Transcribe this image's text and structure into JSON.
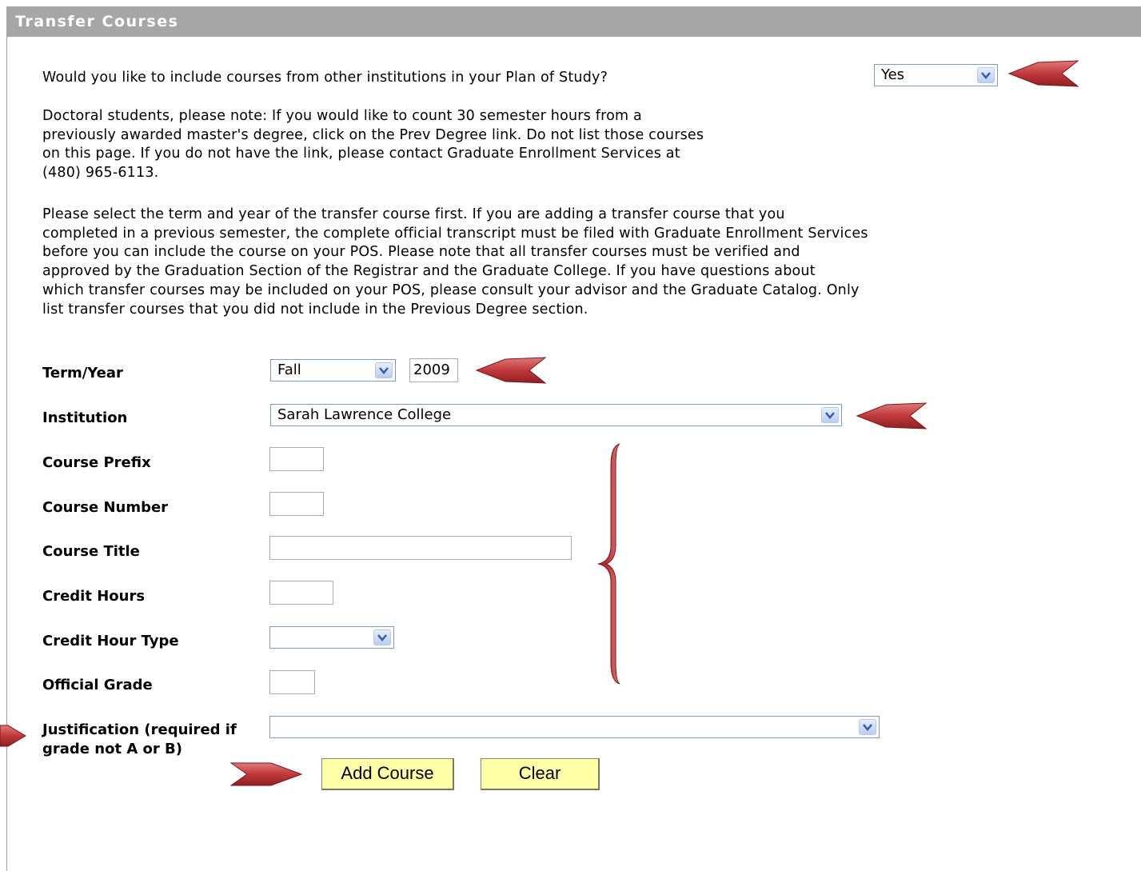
{
  "header": {
    "title": "Transfer Courses"
  },
  "intro": {
    "question": "Would you like to include courses from other institutions in your Plan of Study?",
    "include_value": "Yes",
    "note_lines": [
      "Doctoral students, please note: If you would like to count 30 semester hours from a",
      "previously awarded master's degree, click on the Prev Degree link. Do not list those courses",
      "on this page. If you do not have the link, please contact Graduate Enrollment Services at",
      "(480) 965-6113."
    ],
    "instruction_lines": [
      "Please select the term and year of the transfer course first. If you are adding a transfer course that you",
      "completed in a previous semester, the complete official transcript must be filed with Graduate Enrollment Services",
      "before you can include the course on your POS. Please note that all transfer courses must be verified and",
      "approved by the Graduation Section of the Registrar and the Graduate College. If you have questions about",
      "which transfer courses may be included on your POS, please consult your advisor and the Graduate Catalog. Only",
      "list transfer courses that you did not include in the Previous Degree section."
    ]
  },
  "form": {
    "term_year_label": "Term/Year",
    "term_value": "Fall",
    "year_value": "2009",
    "institution_label": "Institution",
    "institution_value": "Sarah Lawrence College",
    "course_prefix_label": "Course Prefix",
    "course_prefix_value": "",
    "course_number_label": "Course Number",
    "course_number_value": "",
    "course_title_label": "Course Title",
    "course_title_value": "",
    "credit_hours_label": "Credit Hours",
    "credit_hours_value": "",
    "credit_hour_type_label": "Credit Hour Type",
    "credit_hour_type_value": "",
    "official_grade_label": "Official Grade",
    "official_grade_value": "",
    "justification_label_line1": "Justification (required if",
    "justification_label_line2": "grade not A or B)",
    "justification_value": ""
  },
  "buttons": {
    "add_course": "Add Course",
    "clear": "Clear"
  },
  "annotations": {
    "arrow_color": "#c0393b",
    "arrow_edge_color": "#7a1518"
  }
}
